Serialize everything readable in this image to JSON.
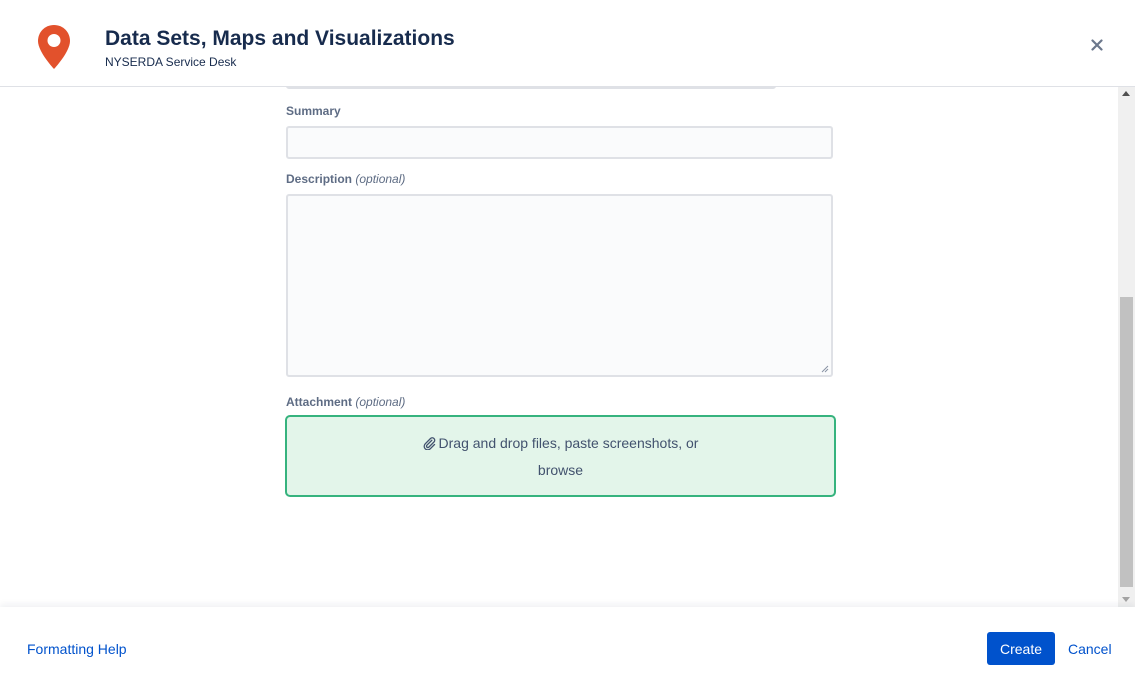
{
  "header": {
    "title": "Data Sets, Maps and Visualizations",
    "subtitle": "NYSERDA Service Desk",
    "logo_icon": "map-pin-icon",
    "close_icon": "close-icon",
    "brand_color": "#e2512c"
  },
  "form": {
    "summary": {
      "label": "Summary",
      "value": ""
    },
    "description": {
      "label": "Description",
      "optional_tag": "(optional)",
      "value": ""
    },
    "attachment": {
      "label": "Attachment",
      "optional_tag": "(optional)",
      "dropzone_text": "Drag and drop files, paste screenshots, or",
      "browse_label": "browse",
      "icon": "paperclip-icon",
      "border_color": "#36b37e",
      "background_color": "#e3f5ea"
    }
  },
  "footer": {
    "help_link": "Formatting Help",
    "create_label": "Create",
    "cancel_label": "Cancel",
    "primary_color": "#0052cc"
  }
}
